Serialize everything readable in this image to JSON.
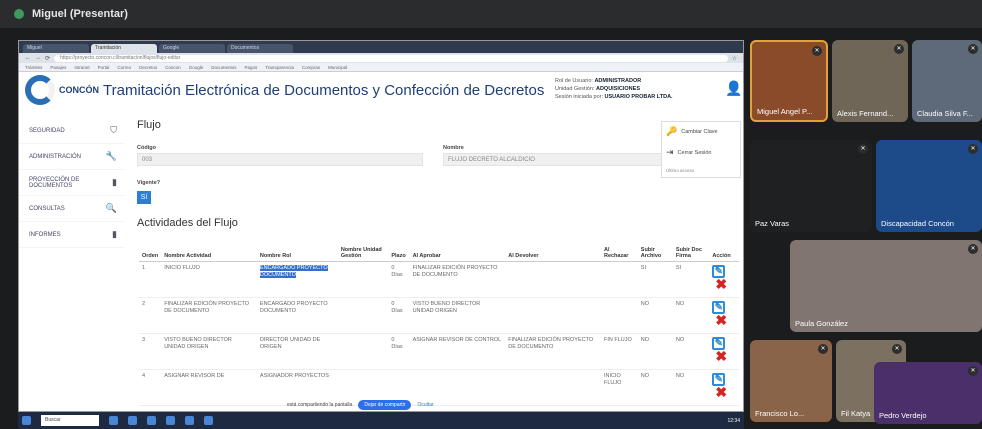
{
  "meeting": {
    "title": "Miguel (Presentar)"
  },
  "browser": {
    "tabs": [
      "Miguel",
      "Tramitación",
      "Google",
      "Documentos"
    ],
    "url": "https://proyecto.concon.cl/tramitacion/flujos/flujo-editar",
    "bookmarks": [
      "Trámites",
      "Pasajes",
      "Intranet",
      "Portal",
      "Correo",
      "Decretos",
      "Concon",
      "Google",
      "Documentos",
      "Pagos",
      "Transparencia",
      "Compras",
      "Municipal"
    ]
  },
  "app": {
    "brand": "CONCÓN",
    "title": "Tramitación Electrónica de Documentos y Confección de Decretos",
    "user": {
      "rol_label": "Rol de Usuario:",
      "rol": "ADMINISTRADOR",
      "unidad_label": "Unidad Gestión:",
      "unidad": "ADQUISICIONES",
      "sesion_label": "Sesión iniciada por:",
      "sesion": "USUARIO PROBAR LTDA."
    },
    "panel": {
      "cambiar_clave": "Cambiar Clave",
      "cerrar_sesion": "Cerrar Sesión",
      "last_label": "Último acceso"
    }
  },
  "sidebar": [
    {
      "label": "SEGURIDAD",
      "icon": "shield-icon",
      "glyph": "⛉"
    },
    {
      "label": "ADMINISTRACIÓN",
      "icon": "wrench-icon",
      "glyph": "🔧"
    },
    {
      "label": "PROYECCIÓN DE DOCUMENTOS",
      "icon": "document-icon",
      "glyph": "▮"
    },
    {
      "label": "CONSULTAS",
      "icon": "search-icon",
      "glyph": "🔍"
    },
    {
      "label": "INFORMES",
      "icon": "file-icon",
      "glyph": "▮"
    }
  ],
  "form": {
    "title": "Flujo",
    "codigo_label": "Código",
    "codigo": "003",
    "nombre_label": "Nombre",
    "nombre": "FLUJO DECRETO ALCALDICIO",
    "vigente_label": "Vigente?",
    "vigente": "Sí",
    "activities_title": "Actividades del Flujo"
  },
  "table": {
    "headers": [
      "Orden",
      "Nombre Actividad",
      "Nombre Rol",
      "Nombre Unidad Gestión",
      "Plazo",
      "Al Aprobar",
      "Al Devolver",
      "Al Rechazar",
      "Subir Archivo",
      "Subir Doc Firma",
      "Acción"
    ],
    "rows": [
      [
        "1",
        "INICIO FLUJO",
        "ENCARGADO PROYECTO DOCUMENTO",
        "",
        "0 Días",
        "FINALIZAR EDICIÓN PROYECTO DE DOCUMENTO",
        "",
        "",
        "SI",
        "SI"
      ],
      [
        "2",
        "FINALIZAR EDICIÓN PROYECTO DE DOCUMENTO",
        "ENCARGADO PROYECTO DOCUMENTO",
        "",
        "0 Días",
        "VISTO BUENO DIRECTOR UNIDAD ORIGEN",
        "",
        "",
        "NO",
        "NO"
      ],
      [
        "3",
        "VISTO BUENO DIRECTOR UNIDAD ORIGEN",
        "DIRECTOR UNIDAD DE ORIGEN",
        "",
        "0 Días",
        "ASIGNAR REVISOR DE CONTROL",
        "FINALIZAR EDICIÓN PROYECTO DE DOCUMENTO",
        "FIN FLUJO",
        "NO",
        "NO"
      ],
      [
        "4",
        "ASIGNAR REVISOR DE",
        "ASIGNADOR PROYECTOS",
        "",
        "",
        "",
        "",
        "INICIO FLUJO",
        "NO",
        "NO"
      ]
    ]
  },
  "toast": {
    "text": "está compartiendo la pantalla",
    "share": "Dejar de compartir",
    "hide": "Ocultar"
  },
  "taskbar": {
    "search": "Buscar",
    "time": "12:34"
  },
  "participants": [
    {
      "name": "Miguel Angel P...",
      "bg": "#8a4b2b"
    },
    {
      "name": "Alexis Fernand...",
      "bg": "#6f6658"
    },
    {
      "name": "Claudia Silva F...",
      "bg": "#5e6a7a"
    },
    {
      "name": "Paz Varas",
      "bg": "#1f2022"
    },
    {
      "name": "Discapacidad Concón",
      "bg": "#1d4b8a"
    },
    {
      "name": "Paula González",
      "bg": "#807570"
    },
    {
      "name": "Francisco Lo...",
      "bg": "#8a6448"
    },
    {
      "name": "Fil Katya",
      "bg": "#7c7060"
    },
    {
      "name": "Pedro Verdejo",
      "bg": "#4a2f6a"
    }
  ]
}
